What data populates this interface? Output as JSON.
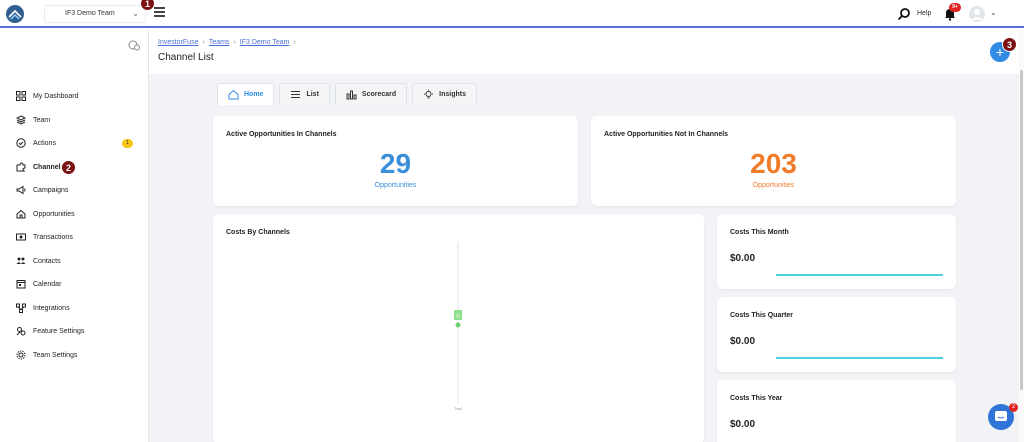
{
  "topbar": {
    "team_select": "IF3 Demo Team",
    "help_label": "Help",
    "notification_count": "9+"
  },
  "annotations": [
    "1",
    "2",
    "3"
  ],
  "sidebar": {
    "items": [
      {
        "label": "My Dashboard",
        "icon": "dashboard-icon"
      },
      {
        "label": "Team",
        "icon": "layers-icon"
      },
      {
        "label": "Actions",
        "icon": "check-circle-icon",
        "count": "1"
      },
      {
        "label": "Channels",
        "icon": "puzzle-icon"
      },
      {
        "label": "Campaigns",
        "icon": "megaphone-icon"
      },
      {
        "label": "Opportunities",
        "icon": "home-icon"
      },
      {
        "label": "Transactions",
        "icon": "money-icon"
      },
      {
        "label": "Contacts",
        "icon": "people-icon"
      },
      {
        "label": "Calendar",
        "icon": "calendar-icon"
      },
      {
        "label": "Integrations",
        "icon": "integrations-icon"
      },
      {
        "label": "Feature Settings",
        "icon": "feature-settings-icon"
      },
      {
        "label": "Team Settings",
        "icon": "gear-icon"
      }
    ]
  },
  "breadcrumb": {
    "items": [
      "InvestorFuse",
      "Teams",
      "IF3 Demo Team"
    ]
  },
  "page": {
    "title": "Channel List"
  },
  "tabs": [
    {
      "label": "Home",
      "icon": "home-icon",
      "active": true
    },
    {
      "label": "List",
      "icon": "list-icon",
      "active": false
    },
    {
      "label": "Scorecard",
      "icon": "bar-chart-icon",
      "active": false
    },
    {
      "label": "Insights",
      "icon": "lightbulb-icon",
      "active": false
    }
  ],
  "cards": {
    "in_channels": {
      "title": "Active Opportunities In Channels",
      "value": "29",
      "sub": "Opportunities",
      "color": "#3b8fd8"
    },
    "not_in_channels": {
      "title": "Active Opportunities Not In Channels",
      "value": "203",
      "sub": "Opportunities",
      "color": "#f07c2a"
    },
    "costs_by_channels": {
      "title": "Costs By Channels",
      "bar_label": "0",
      "axis_label": "Total"
    },
    "costs_month": {
      "title": "Costs This Month",
      "value": "$0.00"
    },
    "costs_quarter": {
      "title": "Costs This Quarter",
      "value": "$0.00"
    },
    "costs_year": {
      "title": "Costs This Year",
      "value": "$0.00"
    }
  },
  "chat": {
    "badge": "2"
  },
  "colors": {
    "accent": "#2f8be6",
    "annotation": "#7b1111",
    "spark": "#4dd0e1"
  }
}
